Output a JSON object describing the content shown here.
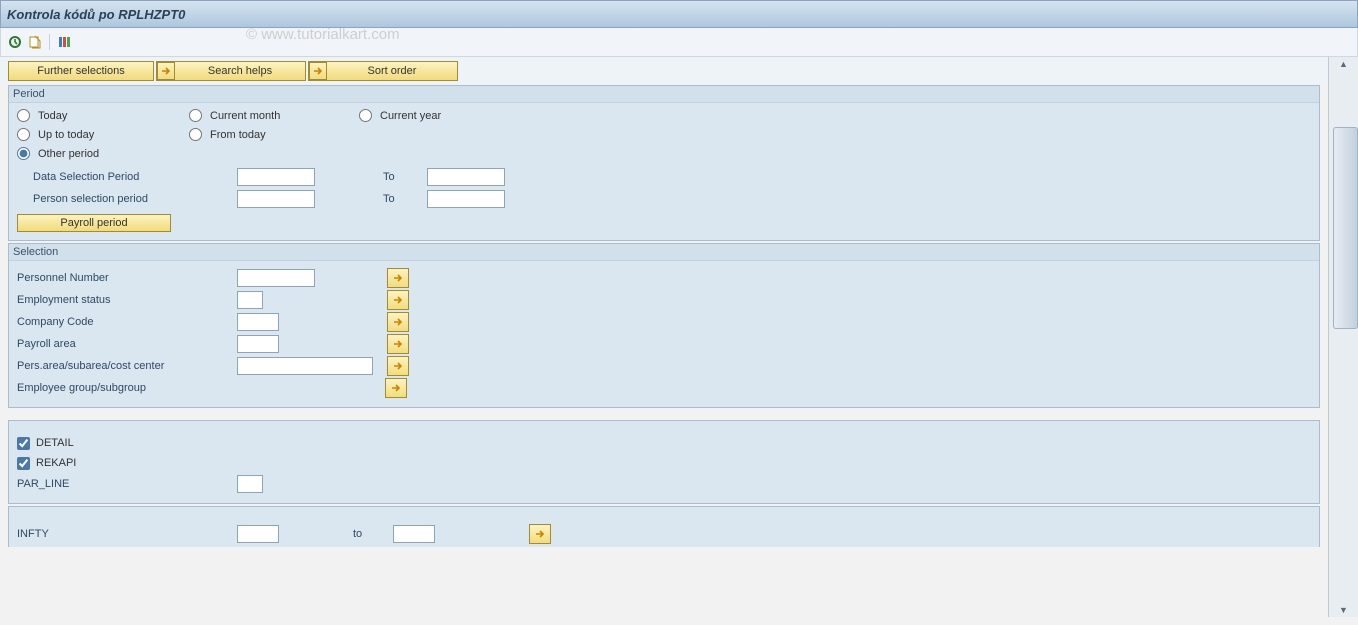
{
  "title": "Kontrola kódů po RPLHZPT0",
  "watermark": "© www.tutorialkart.com",
  "topButtons": {
    "further": "Further selections",
    "search": "Search helps",
    "sort": "Sort order"
  },
  "period": {
    "title": "Period",
    "today": "Today",
    "current_month": "Current month",
    "current_year": "Current year",
    "up_to_today": "Up to today",
    "from_today": "From today",
    "other_period": "Other period",
    "data_sel": "Data Selection Period",
    "person_sel": "Person selection period",
    "to": "To",
    "payroll_btn": "Payroll period"
  },
  "selection": {
    "title": "Selection",
    "personnel": "Personnel Number",
    "emp_status": "Employment status",
    "company": "Company Code",
    "payroll_area": "Payroll area",
    "pers_area": "Pers.area/subarea/cost center",
    "emp_group": "Employee group/subgroup"
  },
  "opts": {
    "detail": "DETAIL",
    "rekapi": "REKAPI",
    "par_line": "PAR_LINE"
  },
  "infty": {
    "label": "INFTY",
    "to": "to"
  }
}
